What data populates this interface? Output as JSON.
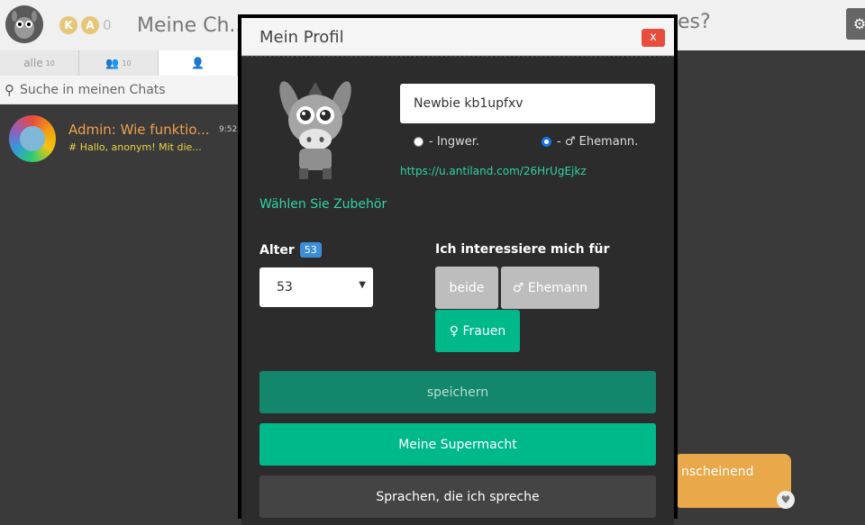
{
  "header": {
    "coin1_icon": "k-coin-icon",
    "coin2_icon": "a-coin-icon",
    "coin_count": "0",
    "page_title": "Meine Ch...",
    "right_title": "es?"
  },
  "tabs": [
    {
      "label": "alle",
      "count": "10"
    },
    {
      "label": "",
      "count": "10"
    },
    {
      "label": ""
    }
  ],
  "search": {
    "placeholder": "Suche in meinen Chats"
  },
  "chat": {
    "name": "Admin: Wie funktio...",
    "preview": "# Hallo, anonym! Mit die...",
    "time": "9:52"
  },
  "bubble": {
    "text": "nscheinend"
  },
  "modal": {
    "title": "Mein Profil",
    "close_label": "x",
    "accessory_link": "Wählen Sie Zubehör",
    "name_value": "Newbie kb1upfxv",
    "radio_option1": "- Ingwer.",
    "radio_option2": "- ♂ Ehemann.",
    "profile_url": "https://u.antiland.com/26HrUgEjkz",
    "age_label": "Alter",
    "age_badge": "53",
    "age_value": "53",
    "interest_label": "Ich interessiere mich für",
    "interest_both": "beide",
    "interest_husband": "♂ Ehemann",
    "interest_women": "♀ Frauen",
    "save_label": "speichern",
    "superpower_label": "Meine Supermacht",
    "languages_label": "Sprachen, die ich spreche"
  },
  "colors": {
    "accent_green": "#00b98b",
    "link_green": "#2ed3a3",
    "close_red": "#e74c3c",
    "chat_name_orange": "#f0a04b"
  }
}
